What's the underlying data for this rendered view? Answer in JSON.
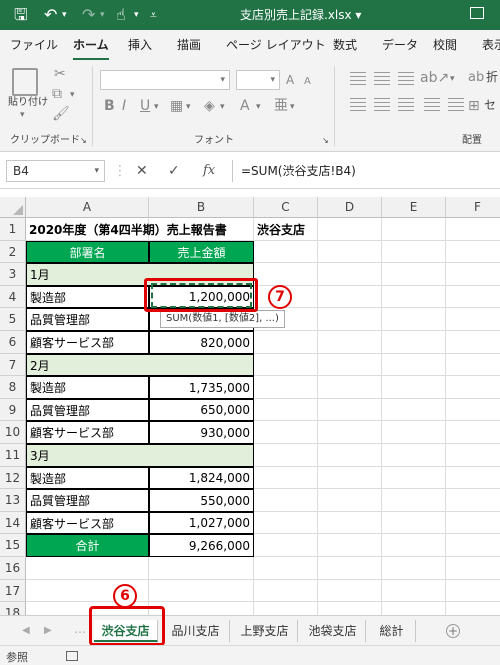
{
  "window": {
    "title": "支店別売上記録.xlsx"
  },
  "ribbon_tabs": [
    "ファイル",
    "ホーム",
    "挿入",
    "描画",
    "ページ レイアウト",
    "数式",
    "データ",
    "校閲",
    "表示"
  ],
  "ribbon": {
    "paste_label": "貼り付け",
    "clipboard_label": "クリップボード",
    "font_label": "フォント",
    "align_label": "配置",
    "wrap_partial": "折"
  },
  "formula_bar": {
    "name_box": "B4",
    "formula": "=SUM(渋谷支店!B4)",
    "fx_label": "fx"
  },
  "columns": [
    "A",
    "B",
    "C",
    "D",
    "E",
    "F"
  ],
  "rows": [
    {
      "n": "1",
      "a": "2020年度（第4四半期）売上報告書",
      "b": "",
      "c": "渋谷支店",
      "type": "title"
    },
    {
      "n": "2",
      "a": "部署名",
      "b": "売上金額",
      "type": "header"
    },
    {
      "n": "3",
      "a": "1月",
      "type": "month"
    },
    {
      "n": "4",
      "a": "製造部",
      "b": "1,200,000",
      "type": "data"
    },
    {
      "n": "5",
      "a": "品質管理部",
      "b": "",
      "type": "data"
    },
    {
      "n": "6",
      "a": "顧客サービス部",
      "b": "820,000",
      "type": "data"
    },
    {
      "n": "7",
      "a": "2月",
      "type": "month"
    },
    {
      "n": "8",
      "a": "製造部",
      "b": "1,735,000",
      "type": "data"
    },
    {
      "n": "9",
      "a": "品質管理部",
      "b": "650,000",
      "type": "data"
    },
    {
      "n": "10",
      "a": "顧客サービス部",
      "b": "930,000",
      "type": "data"
    },
    {
      "n": "11",
      "a": "3月",
      "type": "month"
    },
    {
      "n": "12",
      "a": "製造部",
      "b": "1,824,000",
      "type": "data"
    },
    {
      "n": "13",
      "a": "品質管理部",
      "b": "550,000",
      "type": "data"
    },
    {
      "n": "14",
      "a": "顧客サービス部",
      "b": "1,027,000",
      "type": "data"
    },
    {
      "n": "15",
      "a": "合計",
      "b": "9,266,000",
      "type": "total"
    },
    {
      "n": "16",
      "type": "empty"
    },
    {
      "n": "17",
      "type": "empty"
    },
    {
      "n": "18",
      "type": "empty"
    }
  ],
  "tooltip": "SUM(数値1, [数値2], ...)",
  "annotations": {
    "step7": "7",
    "step6": "6"
  },
  "sheet_tabs": [
    "渋谷支店",
    "品川支店",
    "上野支店",
    "池袋支店",
    "総計"
  ],
  "active_sheet": "渋谷支店",
  "status": {
    "mode": "参照"
  },
  "colors": {
    "accent": "#217346",
    "header_fill": "#00a651",
    "month_fill": "#e2efda",
    "highlight": "#e00000"
  }
}
